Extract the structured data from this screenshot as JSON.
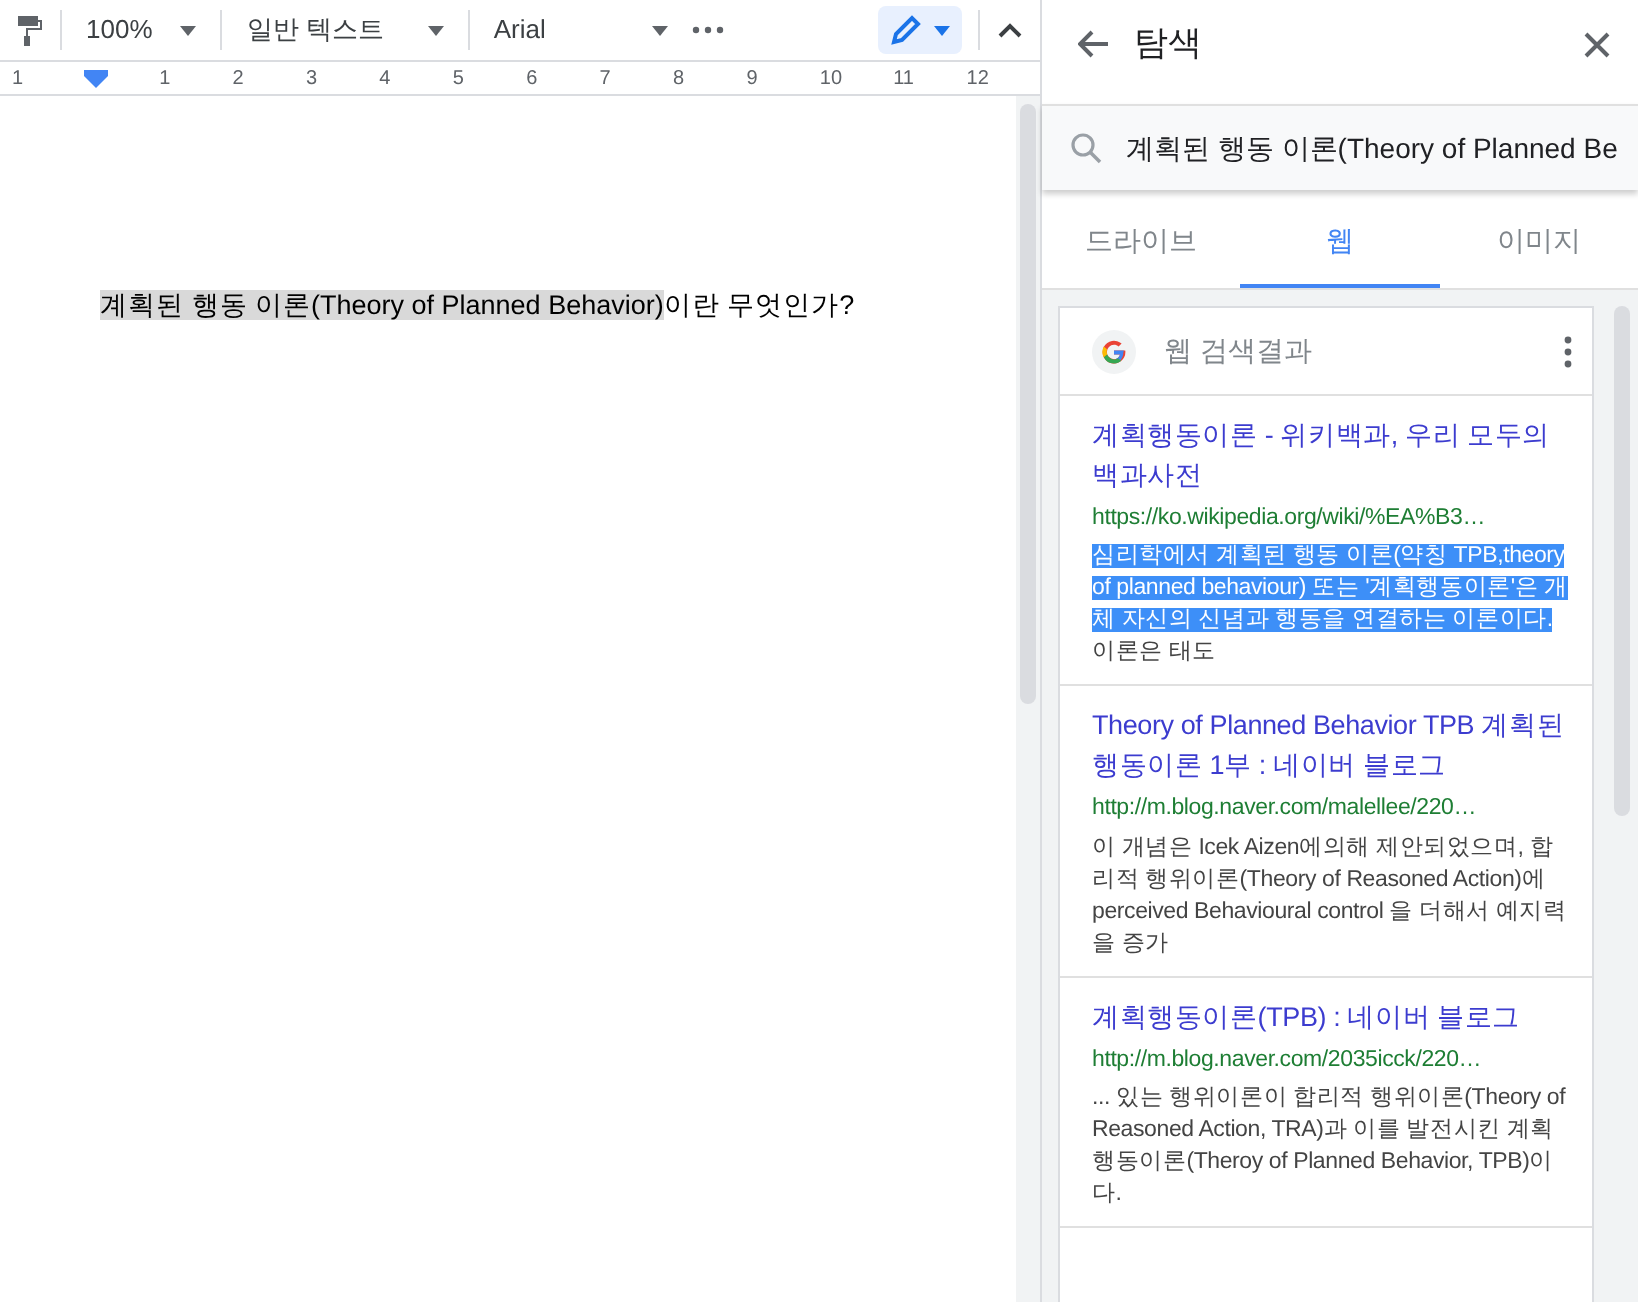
{
  "toolbar": {
    "zoom": "100%",
    "style": "일반 텍스트",
    "font": "Arial",
    "editing_mode_selected": true
  },
  "ruler": {
    "labels": [
      "1",
      "1",
      "2",
      "3",
      "4",
      "5",
      "6",
      "7",
      "8",
      "9",
      "10",
      "11",
      "12"
    ]
  },
  "document": {
    "selected_text": "계획된 행동 이론(Theory of Planned Behavior)",
    "text": "이란 무엇인가?"
  },
  "panel": {
    "title": "탐색",
    "search_value": "계획된 행동 이론(Theory of Planned Be",
    "tabs": [
      {
        "label": "드라이브",
        "selected": false
      },
      {
        "label": "웹",
        "selected": true
      },
      {
        "label": "이미지",
        "selected": false
      }
    ],
    "results_header": "웹 검색결과",
    "results": [
      {
        "title": "계획행동이론 - 위키백과, 우리 모두의 백과사전",
        "url": "https://ko.wikipedia.org/wiki/%EA%B3…",
        "highlighted_snippet": "심리학에서 계획된 행동 이론(약칭 TPB,theory of planned behaviour) 또는 '계획행동이론'은 개체 자신의 신념과 행동을 연결하는 이론이다.",
        "snippet": "이론은 태도"
      },
      {
        "title": "Theory of Planned Behavior TPB 계획된 행동이론 1부 : 네이버 블로그",
        "url": "http://m.blog.naver.com/malellee/220…",
        "snippet": "이 개념은 Icek Aizen에의해 제안되었으며, 합리적 행위이론(Theory of Reasoned Action)에 perceived Behavioural control 을 더해서 예지력을 증가"
      },
      {
        "title": "계획행동이론(TPB) : 네이버 블로그",
        "url": "http://m.blog.naver.com/2035icck/220…",
        "snippet": "... 있는 행위이론이 합리적 행위이론(Theory of Reasoned Action, TRA)과 이를 발전시킨 계획행동이론(Theroy of Planned Behavior, TPB)이다."
      }
    ]
  }
}
